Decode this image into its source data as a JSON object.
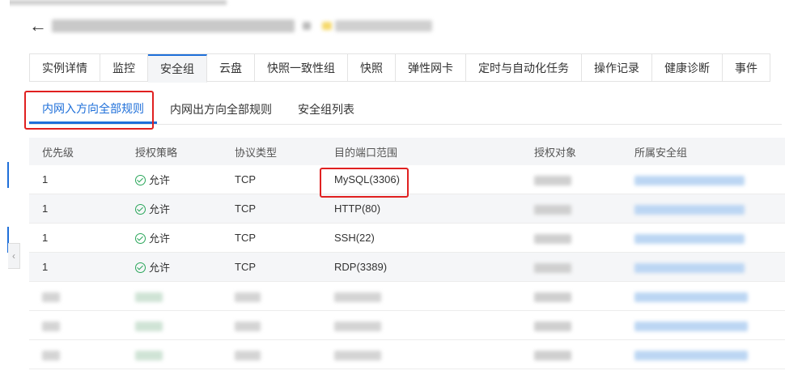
{
  "nav": {
    "back_icon": "arrow-left-icon"
  },
  "tabs": [
    "实例详情",
    "监控",
    "安全组",
    "云盘",
    "快照一致性组",
    "快照",
    "弹性网卡",
    "定时与自动化任务",
    "操作记录",
    "健康诊断",
    "事件"
  ],
  "active_tab": "安全组",
  "subtabs": [
    "内网入方向全部规则",
    "内网出方向全部规则",
    "安全组列表"
  ],
  "active_subtab": "内网入方向全部规则",
  "table": {
    "columns": [
      "优先级",
      "授权策略",
      "协议类型",
      "目的端口范围",
      "授权对象",
      "所属安全组"
    ],
    "rows": [
      {
        "priority": "1",
        "policy": "允许",
        "protocol": "TCP",
        "port": "MySQL(3306)"
      },
      {
        "priority": "1",
        "policy": "允许",
        "protocol": "TCP",
        "port": "HTTP(80)"
      },
      {
        "priority": "1",
        "policy": "允许",
        "protocol": "TCP",
        "port": "SSH(22)"
      },
      {
        "priority": "1",
        "policy": "允许",
        "protocol": "TCP",
        "port": "RDP(3389)"
      }
    ]
  },
  "colors": {
    "accent": "#1e6fd9",
    "allow_green": "#2aa65a",
    "highlight_red": "#e02020"
  }
}
